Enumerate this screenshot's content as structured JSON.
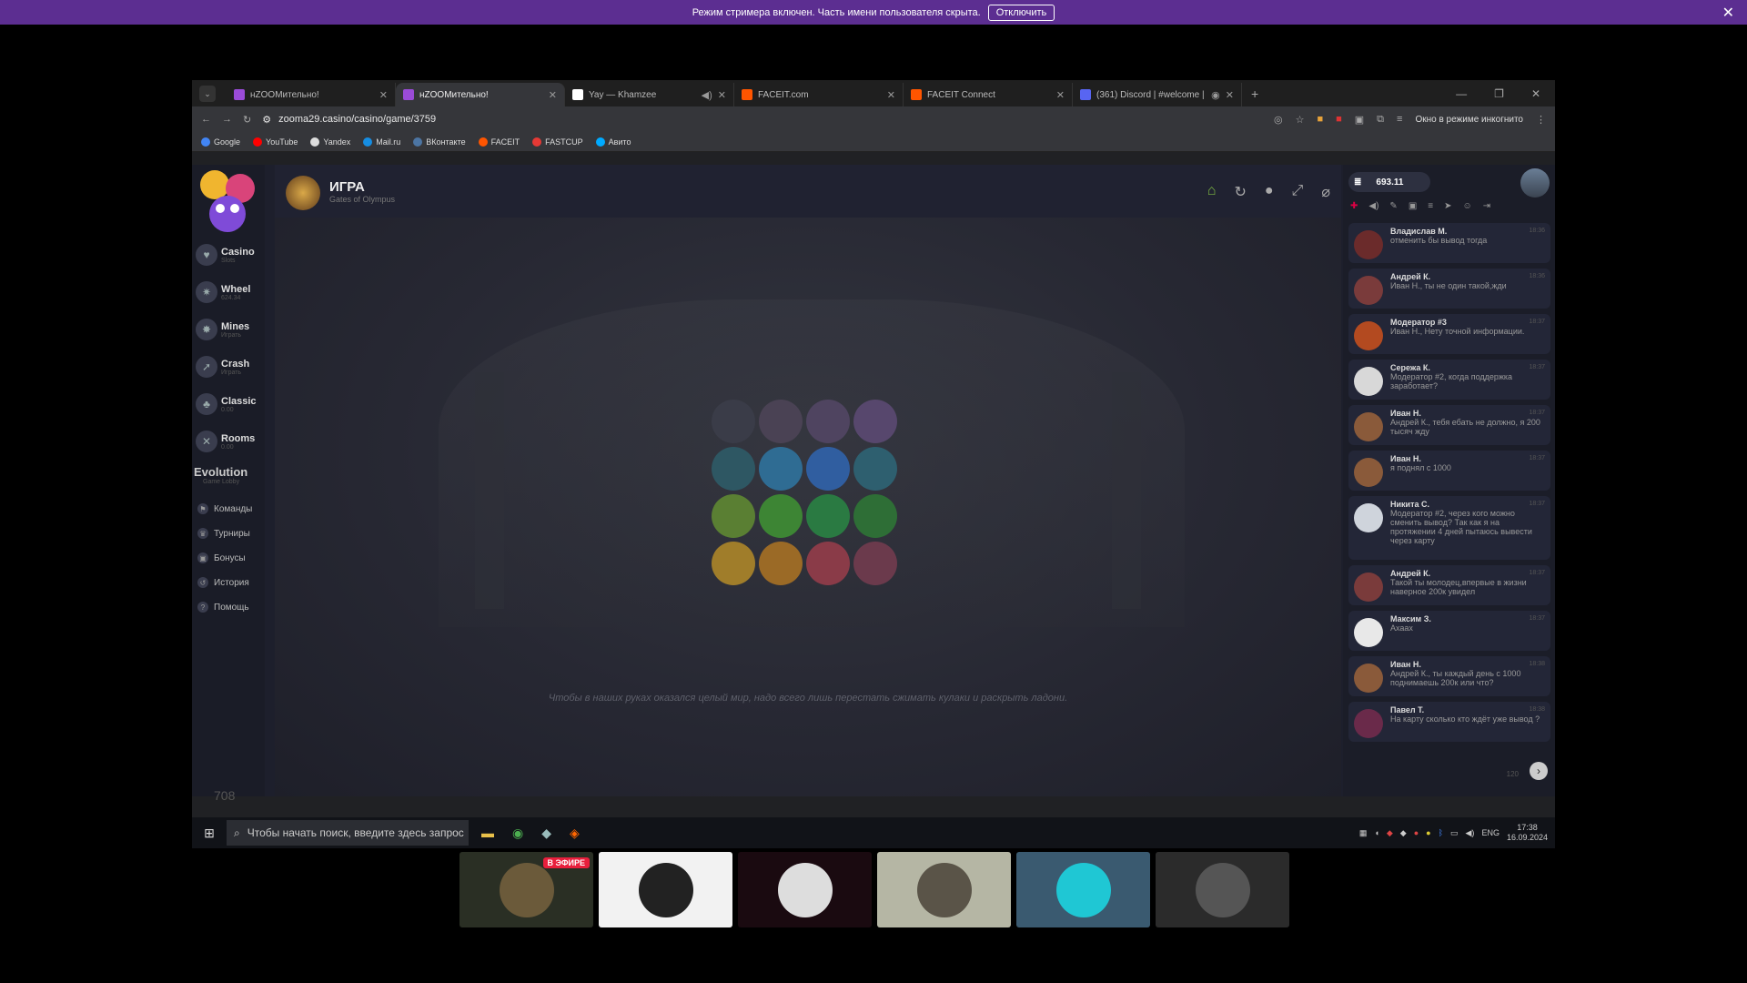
{
  "streamer_banner": {
    "text": "Режим стримера включен. Часть имени пользователя скрыта.",
    "button": "Отключить",
    "close": "✕"
  },
  "browser": {
    "tabs": [
      {
        "title": "нZOOМительно!",
        "color": "#9a4bd8"
      },
      {
        "title": "нZOOМительно!",
        "color": "#9a4bd8"
      },
      {
        "title": "Yay — Khamzee",
        "color": "#ffffff"
      },
      {
        "title": "FACEIT.com",
        "color": "#ff5500"
      },
      {
        "title": "FACEIT Connect",
        "color": "#ff5500"
      },
      {
        "title": "(361) Discord | #welcome |",
        "color": "#5865f2"
      }
    ],
    "url": "zooma29.casino/casino/game/3759",
    "incognito_label": "Окно в режиме инкогнито",
    "bookmarks": [
      {
        "label": "Google",
        "color": "#4285f4"
      },
      {
        "label": "YouTube",
        "color": "#ff0000"
      },
      {
        "label": "Yandex",
        "color": "#dddddd"
      },
      {
        "label": "Mail.ru",
        "color": "#168de2"
      },
      {
        "label": "ВКонтакте",
        "color": "#4c75a3"
      },
      {
        "label": "FACEIT",
        "color": "#ff5500"
      },
      {
        "label": "FASTCUP",
        "color": "#e53935"
      },
      {
        "label": "Авито",
        "color": "#00aaff"
      }
    ]
  },
  "sidebar": {
    "items": [
      {
        "label": "Casino",
        "sub": "Slots"
      },
      {
        "label": "Wheel",
        "sub": "624.34"
      },
      {
        "label": "Mines",
        "sub": "Играть"
      },
      {
        "label": "Crash",
        "sub": "Играть"
      },
      {
        "label": "Classic",
        "sub": "0.00"
      },
      {
        "label": "Rooms",
        "sub": "0.00"
      }
    ],
    "evolution": {
      "label": "Evolution",
      "sub": "Game Lobby"
    },
    "links": [
      "Команды",
      "Турниры",
      "Бонусы",
      "История",
      "Помощь"
    ],
    "online_count": "708"
  },
  "game": {
    "title": "ИГРА",
    "subtitle": "Gates of Olympus",
    "loading_quote": "Чтобы в наших руках оказался целый мир, надо всего лишь перестать сжимать кулаки и раскрыть ладони.",
    "dot_colors": [
      "#3a3c48",
      "#4a4254",
      "#4f4460",
      "#57476d",
      "#2e5763",
      "#2f6c93",
      "#305ea0",
      "#2e5f6f",
      "#5a7f33",
      "#3d8534",
      "#2a7a42",
      "#2e6e36",
      "#a07d2a",
      "#9b6a26",
      "#8a3b48",
      "#6b3a4c"
    ]
  },
  "chat": {
    "balance": "693.11",
    "messages": [
      {
        "name": "Владислав М.",
        "text": "отменить бы вывод тогда",
        "time": "18:36",
        "color": "#6b2b2b"
      },
      {
        "name": "Андрей К.",
        "text": "Иван Н., ты не один такой,жди",
        "time": "18:36",
        "color": "#7a3b3b"
      },
      {
        "name": "Модератор #3",
        "text": "Иван Н., Нету точной информации.",
        "time": "18:37",
        "color": "#b34a20"
      },
      {
        "name": "Сережа К.",
        "text": "Модератор #2, когда поддержка заработает?",
        "time": "18:37",
        "color": "#d8d8d8"
      },
      {
        "name": "Иван Н.",
        "text": "Андрей К., тебя ебать не должно, я 200 тысяч жду",
        "time": "18:37",
        "color": "#8a5a3a"
      },
      {
        "name": "Иван Н.",
        "text": "я поднял с 1000",
        "time": "18:37",
        "color": "#8a5a3a"
      },
      {
        "name": "Никита С.",
        "text": "Модератор #2, через кого можно сменить вывод? Так как я на протяжении 4 дней пытаюсь вывести через карту",
        "time": "18:37",
        "color": "#cfd4dc"
      },
      {
        "name": "Андрей К.",
        "text": "Такой ты молодец,впервые в жизни наверное 200к увидел",
        "time": "18:37",
        "color": "#7a3b3b"
      },
      {
        "name": "Максим З.",
        "text": "Ахаах",
        "time": "18:37",
        "color": "#e8e8e8"
      },
      {
        "name": "Иван Н.",
        "text": "Андрей К., ты каждый день с 1000 поднимаешь 200к или что?",
        "time": "18:38",
        "color": "#8a5a3a"
      },
      {
        "name": "Павел Т.",
        "text": "На карту сколько кто ждёт уже вывод ?",
        "time": "18:38",
        "color": "#6a2a4a"
      }
    ],
    "char_counter": "120"
  },
  "taskbar": {
    "search_placeholder": "Чтобы начать поиск, введите здесь запрос",
    "lang": "ENG",
    "time": "17:38",
    "date": "16.09.2024"
  },
  "streams": {
    "live_badge": "В ЭФИРЕ",
    "thumb_colors": [
      "#2a2f24",
      "#f2f2f2",
      "#1a0a10",
      "#b5b6a4",
      "#3a5a70",
      "#2b2b2b"
    ]
  }
}
